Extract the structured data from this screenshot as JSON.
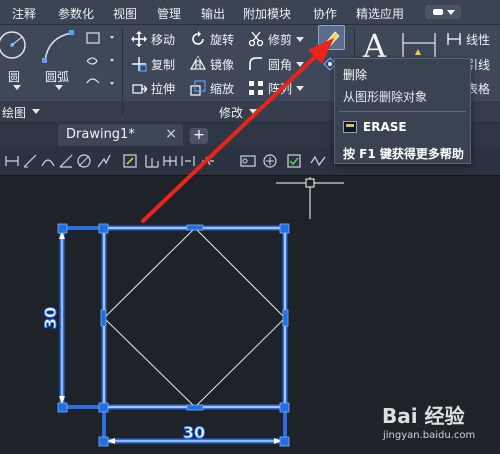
{
  "menu": {
    "items": [
      "注释",
      "参数化",
      "视图",
      "管理",
      "输出",
      "附加模块",
      "协作",
      "精选应用"
    ]
  },
  "ribbon": {
    "draw_panel": {
      "circle_label": "圆",
      "arc_label": "圆弧",
      "panel_title": "绘图"
    },
    "modify_panel": {
      "move": "移动",
      "rotate": "旋转",
      "trim": "修剪",
      "copy": "复制",
      "mirror": "镜像",
      "fillet": "圆角",
      "stretch": "拉伸",
      "scale": "缩放",
      "array": "阵列",
      "panel_title": "修改"
    },
    "annotation_panel": {
      "text_glyph": "A",
      "linear": "线性",
      "leader_partial": "引线",
      "table_partial": "表格"
    }
  },
  "tooltip": {
    "title": "删除",
    "description": "从图形删除对象",
    "command": "ERASE",
    "help": "按 F1 键获得更多帮助"
  },
  "tabs": {
    "active": "Drawing1*",
    "close": "×",
    "add": "+"
  },
  "drawing": {
    "dim_horizontal": "30",
    "dim_vertical": "30"
  },
  "watermark": {
    "brand": "Bai 经验",
    "site": "jingyan.baidu.com"
  },
  "colors": {
    "accent": "#3b7ddd",
    "annotation_arrow": "#e8241c",
    "grip": "#1f6fe0",
    "selection": "#2f7bff"
  }
}
